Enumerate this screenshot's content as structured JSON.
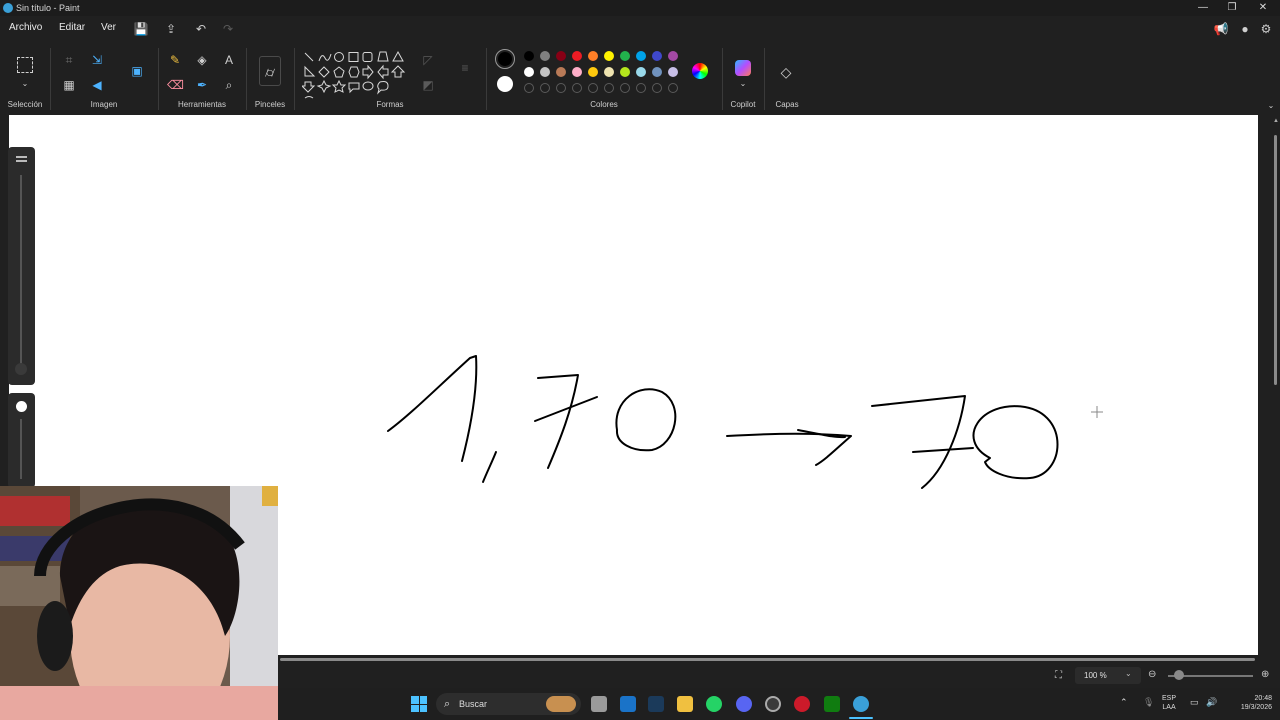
{
  "window": {
    "title": "Sin título - Paint"
  },
  "menu": {
    "archivo": "Archivo",
    "editar": "Editar",
    "ver": "Ver"
  },
  "ribbon": {
    "groups": {
      "seleccion": "Selección",
      "imagen": "Imagen",
      "herramientas": "Herramientas",
      "pinceles": "Pinceles",
      "formas": "Formas",
      "colores": "Colores",
      "copilot": "Copilot",
      "capas": "Capas"
    },
    "palette_row1": [
      "#000000",
      "#7f7f7f",
      "#880015",
      "#ed1c24",
      "#ff7f27",
      "#fff200",
      "#22b14c",
      "#00a2e8",
      "#3f48cc",
      "#a349a4"
    ],
    "palette_row2": [
      "#ffffff",
      "#c3c3c3",
      "#b97a57",
      "#ffaec9",
      "#ffc90e",
      "#efe4b0",
      "#b5e61d",
      "#99d9ea",
      "#7092be",
      "#c8bfe7"
    ],
    "color1": "#000000",
    "color2": "#ffffff"
  },
  "status": {
    "zoom": "100 %"
  },
  "taskbar": {
    "search_placeholder": "Buscar",
    "lang_top": "ESP",
    "lang_bottom": "LAA",
    "time": "20:48",
    "date": "19/3/2026"
  }
}
